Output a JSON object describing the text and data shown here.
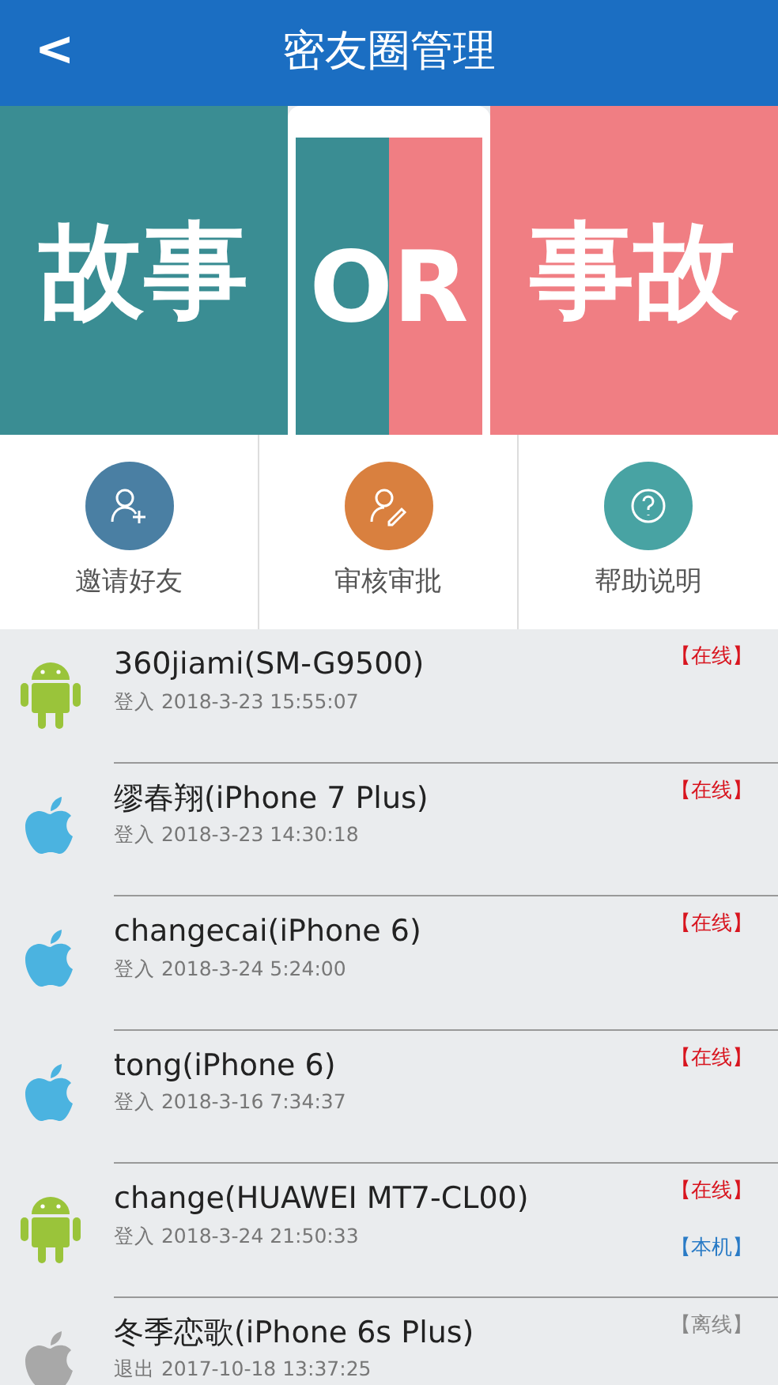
{
  "header": {
    "back": "<",
    "title": "密友圈管理"
  },
  "banner": {
    "left": "故事",
    "middle": "OR",
    "right": "事故"
  },
  "actions": [
    {
      "label": "邀请好友",
      "kind": "invite",
      "color": "#4a7fa3"
    },
    {
      "label": "审核审批",
      "kind": "review",
      "color": "#d9803f"
    },
    {
      "label": "帮助说明",
      "kind": "help",
      "color": "#48a3a3"
    }
  ],
  "devices": [
    {
      "name": "360jiami(SM-G9500)",
      "time": "登入 2018-3-23 15:55:07",
      "kind": "android",
      "online": true,
      "status": "【在线】"
    },
    {
      "name": "缪春翔(iPhone 7 Plus)",
      "time": "登入 2018-3-23 14:30:18",
      "kind": "ios",
      "online": true,
      "status": "【在线】"
    },
    {
      "name": "changecai(iPhone 6)",
      "time": "登入 2018-3-24 5:24:00",
      "kind": "ios",
      "online": true,
      "status": "【在线】"
    },
    {
      "name": "tong(iPhone 6)",
      "time": "登入 2018-3-16 7:34:37",
      "kind": "ios",
      "online": true,
      "status": "【在线】"
    },
    {
      "name": "change(HUAWEI MT7-CL00)",
      "time": "登入 2018-3-24 21:50:33",
      "kind": "android",
      "online": true,
      "status": "【在线】",
      "tag": "【本机】"
    },
    {
      "name": "冬季恋歌(iPhone 6s Plus)",
      "time": "退出 2017-10-18 13:37:25",
      "kind": "ios",
      "online": false,
      "status": "【离线】"
    }
  ]
}
